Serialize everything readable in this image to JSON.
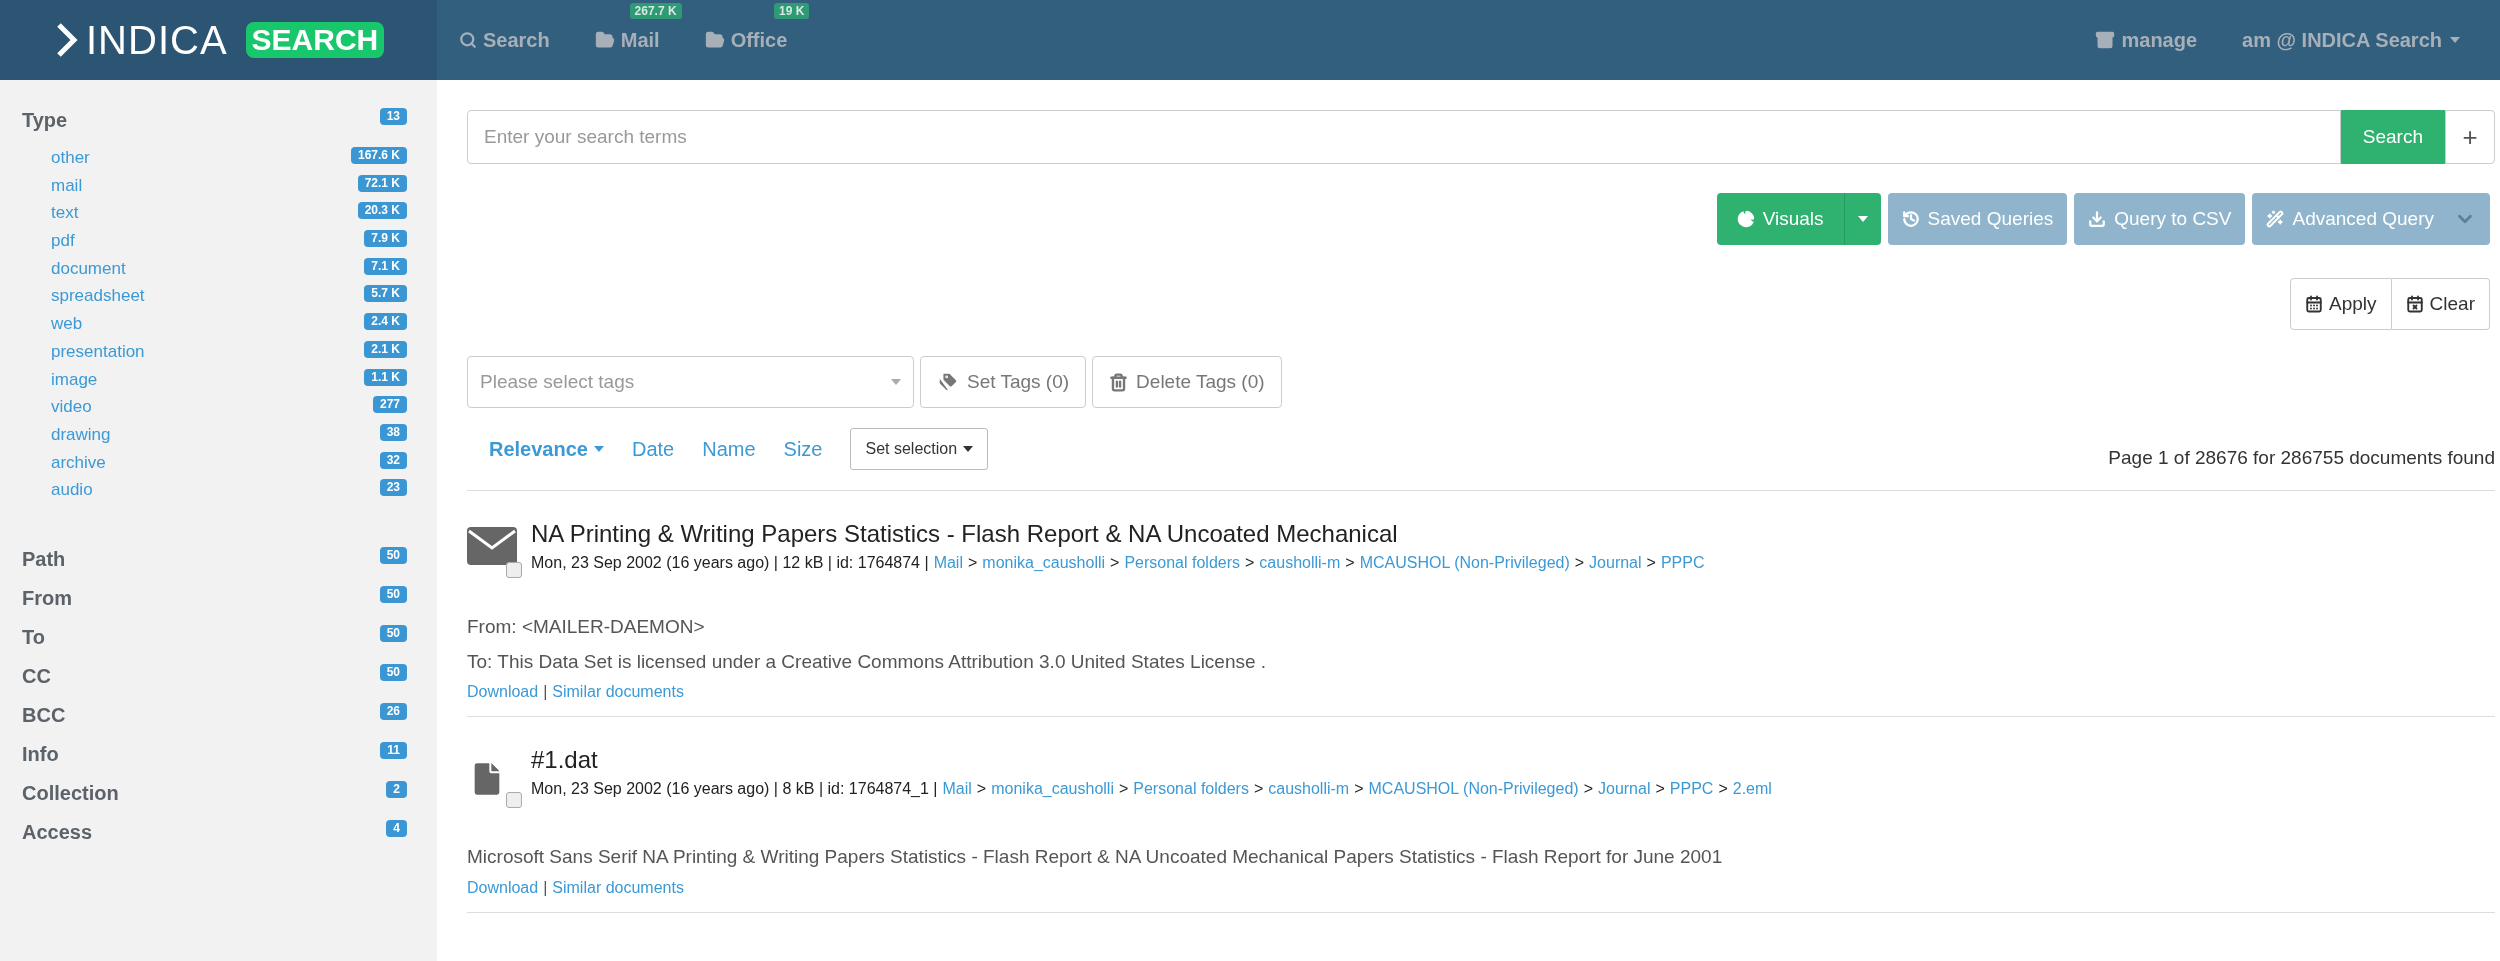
{
  "header": {
    "logo": {
      "word": "INDICA",
      "tag": "SEARCH"
    },
    "nav": [
      {
        "kind": "search",
        "label": "Search"
      },
      {
        "kind": "folder",
        "label": "Mail",
        "badge": "267.7 K"
      },
      {
        "kind": "folder",
        "label": "Office",
        "badge": "19 K"
      }
    ],
    "manage": "manage",
    "user": "am @ INDICA Search"
  },
  "sidebar": {
    "facets": [
      {
        "label": "Type",
        "count": "13",
        "children": [
          {
            "label": "other",
            "count": "167.6 K"
          },
          {
            "label": "mail",
            "count": "72.1 K"
          },
          {
            "label": "text",
            "count": "20.3 K"
          },
          {
            "label": "pdf",
            "count": "7.9 K"
          },
          {
            "label": "document",
            "count": "7.1 K"
          },
          {
            "label": "spreadsheet",
            "count": "5.7 K"
          },
          {
            "label": "web",
            "count": "2.4 K"
          },
          {
            "label": "presentation",
            "count": "2.1 K"
          },
          {
            "label": "image",
            "count": "1.1 K"
          },
          {
            "label": "video",
            "count": "277"
          },
          {
            "label": "drawing",
            "count": "38"
          },
          {
            "label": "archive",
            "count": "32"
          },
          {
            "label": "audio",
            "count": "23"
          }
        ]
      },
      {
        "label": "Path",
        "count": "50"
      },
      {
        "label": "From",
        "count": "50"
      },
      {
        "label": "To",
        "count": "50"
      },
      {
        "label": "CC",
        "count": "50"
      },
      {
        "label": "BCC",
        "count": "26"
      },
      {
        "label": "Info",
        "count": "11"
      },
      {
        "label": "Collection",
        "count": "2"
      },
      {
        "label": "Access",
        "count": "4"
      }
    ]
  },
  "search": {
    "placeholder": "Enter your search terms",
    "button": "Search",
    "add": "+"
  },
  "toolbar": [
    {
      "kind": "visuals",
      "label": "Visuals"
    },
    {
      "kind": "saved",
      "label": "Saved Queries"
    },
    {
      "kind": "csv",
      "label": "Query to CSV"
    },
    {
      "kind": "advanced",
      "label": "Advanced Query"
    }
  ],
  "date_actions": [
    {
      "kind": "apply",
      "label": "Apply"
    },
    {
      "kind": "clear",
      "label": "Clear"
    }
  ],
  "tags": {
    "placeholder": "Please select tags",
    "set": "Set Tags (0)",
    "delete": "Delete Tags (0)"
  },
  "sort": [
    {
      "label": "Relevance",
      "selected": true
    },
    {
      "label": "Date",
      "selected": false
    },
    {
      "label": "Name",
      "selected": false
    },
    {
      "label": "Size",
      "selected": false
    }
  ],
  "set_selection": "Set selection",
  "summary": "Page 1 of 28676 for 286755 documents found",
  "results": [
    {
      "kind": "mail",
      "checked": false,
      "title": "NA Printing & Writing Papers Statistics - Flash Report & NA Uncoated Mechanical",
      "meta": "Mon, 23 Sep 2002 (16 years ago) | 12 kB | id: 1764874 |",
      "separator": ">",
      "path": [
        "Mail",
        "monika_causholli",
        "Personal folders",
        "causholli-m",
        "MCAUSHOL (Non-Privileged)",
        "Journal",
        "PPPC"
      ],
      "body": [
        "From: <MAILER-DAEMON>",
        "To: This Data Set is licensed under a Creative Commons Attribution 3.0 United States License ."
      ],
      "actions": [
        "Download",
        "Similar documents"
      ],
      "action_separator": "|"
    },
    {
      "kind": "file",
      "checked": false,
      "title": "#1.dat",
      "meta": "Mon, 23 Sep 2002 (16 years ago) | 8 kB | id: 1764874_1 |",
      "separator": ">",
      "path": [
        "Mail",
        "monika_causholli",
        "Personal folders",
        "causholli-m",
        "MCAUSHOL (Non-Privileged)",
        "Journal",
        "PPPC",
        "2.eml"
      ],
      "body": [
        "Microsoft Sans Serif NA Printing & Writing Papers Statistics - Flash Report & NA Uncoated Mechanical Papers Statistics - Flash Report for June 2001"
      ],
      "actions": [
        "Download",
        "Similar documents"
      ],
      "action_separator": "|"
    }
  ]
}
